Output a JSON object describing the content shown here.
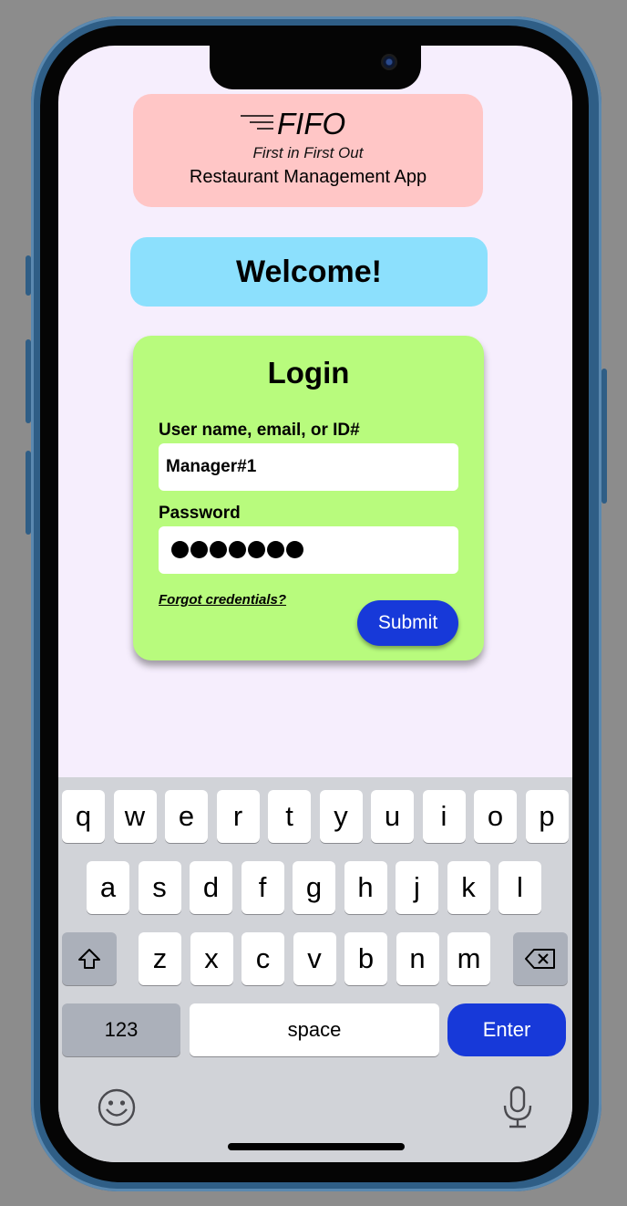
{
  "app": {
    "logo_name": "FIFO",
    "tagline": "First in First Out",
    "subtitle": "Restaurant Management App"
  },
  "welcome": {
    "text": "Welcome!"
  },
  "login": {
    "title": "Login",
    "username_label": "User name, email, or ID#",
    "username_value": "Manager#1",
    "password_label": "Password",
    "password_masked_length": 7,
    "forgot_link": "Forgot credentials?",
    "submit_label": "Submit"
  },
  "keyboard": {
    "row1": [
      "q",
      "w",
      "e",
      "r",
      "t",
      "y",
      "u",
      "i",
      "o",
      "p"
    ],
    "row2": [
      "a",
      "s",
      "d",
      "f",
      "g",
      "h",
      "j",
      "k",
      "l"
    ],
    "row3": [
      "z",
      "x",
      "c",
      "v",
      "b",
      "n",
      "m"
    ],
    "numbers_label": "123",
    "space_label": "space",
    "enter_label": "Enter",
    "icons": [
      "shift-icon",
      "backspace-icon",
      "emoji-icon",
      "microphone-icon"
    ]
  },
  "colors": {
    "logo_card": "#ffc6c6",
    "welcome_card": "#8ce0fd",
    "login_card": "#b8fb7d",
    "accent_button": "#1739d9",
    "screen_background": "#f6eefd"
  }
}
